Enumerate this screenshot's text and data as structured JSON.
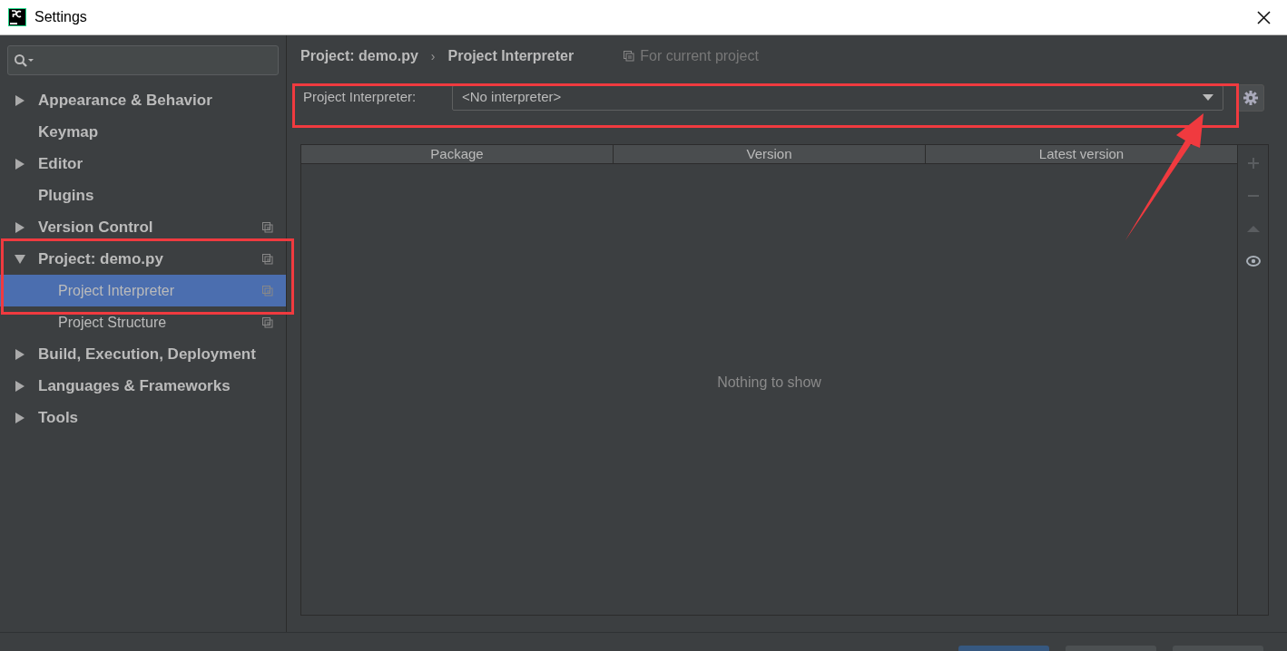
{
  "window": {
    "title": "Settings"
  },
  "sidebar": {
    "items": [
      {
        "label": "Appearance & Behavior",
        "kind": "group",
        "expanded": false,
        "project_scope": false,
        "selected": false
      },
      {
        "label": "Keymap",
        "kind": "leaf",
        "project_scope": false,
        "selected": false
      },
      {
        "label": "Editor",
        "kind": "group",
        "expanded": false,
        "project_scope": false,
        "selected": false
      },
      {
        "label": "Plugins",
        "kind": "leaf",
        "project_scope": false,
        "selected": false
      },
      {
        "label": "Version Control",
        "kind": "group",
        "expanded": false,
        "project_scope": true,
        "selected": false
      },
      {
        "label": "Project: demo.py",
        "kind": "group",
        "expanded": true,
        "project_scope": true,
        "selected": false,
        "children": [
          {
            "label": "Project Interpreter",
            "project_scope": true,
            "selected": true
          },
          {
            "label": "Project Structure",
            "project_scope": true,
            "selected": false
          }
        ]
      },
      {
        "label": "Build, Execution, Deployment",
        "kind": "group",
        "expanded": false,
        "project_scope": false,
        "selected": false
      },
      {
        "label": "Languages & Frameworks",
        "kind": "group",
        "expanded": false,
        "project_scope": false,
        "selected": false
      },
      {
        "label": "Tools",
        "kind": "group",
        "expanded": false,
        "project_scope": false,
        "selected": false
      }
    ]
  },
  "breadcrumb": [
    "Project: demo.py",
    "Project Interpreter"
  ],
  "breadcrumb_separator": "›",
  "scope_note": "For current project",
  "interpreter": {
    "label": "Project Interpreter:",
    "value": "<No interpreter>"
  },
  "table": {
    "columns": [
      "Package",
      "Version",
      "Latest version"
    ],
    "empty_text": "Nothing to show"
  },
  "toolbar": [
    {
      "kind": "add",
      "disabled": true
    },
    {
      "kind": "remove",
      "disabled": true
    },
    {
      "kind": "upgrade",
      "disabled": true
    },
    {
      "kind": "show",
      "disabled": false
    }
  ]
}
